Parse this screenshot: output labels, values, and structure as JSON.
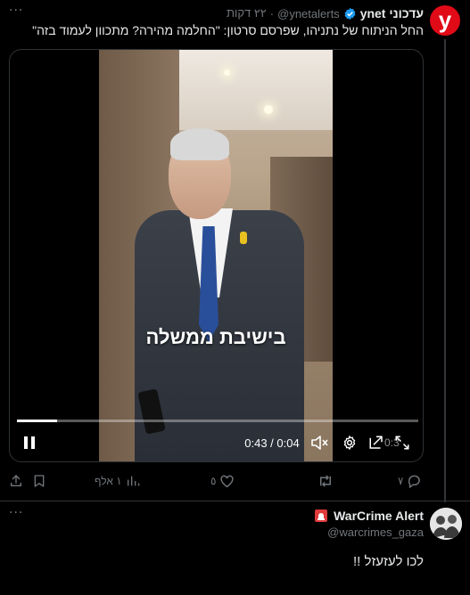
{
  "tweet1": {
    "author_name": "ynet עדכוני",
    "handle": "@ynetalerts",
    "separator": "·",
    "time": "٢٢ דקות",
    "avatar_letter": "y",
    "text": "החל הניתוח של נתניהו, שפרסם סרטון: \"החלמה מהירה? מתכוון לעמוד בזה\"",
    "more": "···",
    "video": {
      "caption": "בישיבת ממשלה",
      "time_display": "0:43 / 0:04",
      "ghost_time": "0:3",
      "progress_fraction": 0.1
    },
    "actions": {
      "replies": "٧",
      "retweets": "",
      "likes": "٥",
      "views": "١ אלף"
    }
  },
  "tweet2": {
    "author_name": "WarCrime Alert",
    "handle": "@warcrimes_gaza",
    "text": "לכו לעזעזל !!",
    "more": "···"
  },
  "colors": {
    "background": "#000000",
    "text": "#e7e9ea",
    "muted": "#71767b",
    "verified": "#1d9bf0",
    "ynet_red": "#e10a17"
  },
  "icons": {
    "verified": "verified-badge-icon",
    "siren": "siren-icon",
    "pause": "pause-icon",
    "mute": "volume-muted-icon",
    "settings": "gear-icon",
    "pip": "picture-in-picture-icon",
    "fullscreen": "fullscreen-icon",
    "reply": "reply-icon",
    "retweet": "retweet-icon",
    "like": "heart-icon",
    "views": "views-chart-icon",
    "bookmark": "bookmark-icon",
    "share": "share-icon"
  }
}
